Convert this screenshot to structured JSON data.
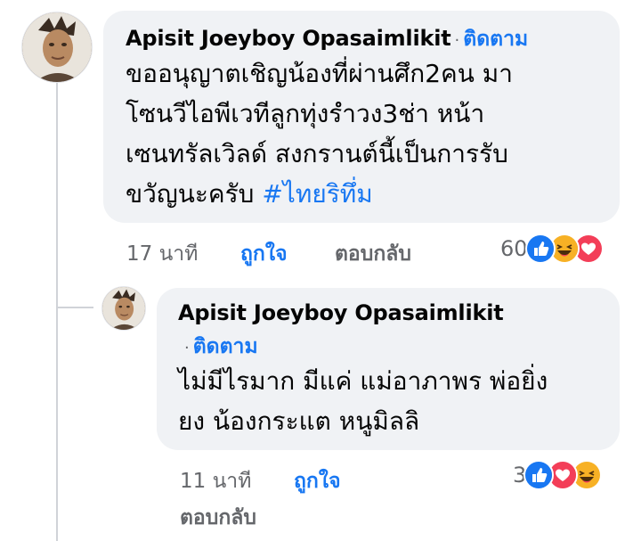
{
  "comment": {
    "author": "Apisit Joeyboy Opasaimlikit",
    "separator": "·",
    "follow_label": "ติดตาม",
    "text_lines": [
      "ขออนุญาตเชิญน้องที่ผ่านศึก2คน มา",
      "โซนวีไอพีเวทีลูกทุ่งรำวง3ช่า หน้า",
      "เซนทรัลเวิลด์ สงกรานต์นี้เป็นการรับ",
      "ขวัญนะครับ "
    ],
    "hashtag": "#ไทยริทึ่ม",
    "time": "17 นาที",
    "like_label": "ถูกใจ",
    "reply_label": "ตอบกลับ",
    "reaction_count": "60",
    "reactions": [
      "like-icon",
      "haha-icon",
      "love-icon"
    ]
  },
  "reply": {
    "author": "Apisit Joeyboy Opasaimlikit",
    "separator": "·",
    "follow_label": "ติดตาม",
    "text_lines": [
      "ไม่มีไรมาก มีแค่ แม่อาภาพร พ่อยิ่ง",
      "ยง น้องกระแต หนูมิลลิ"
    ],
    "time": "11 นาที",
    "like_label": "ถูกใจ",
    "reply_label": "ตอบกลับ",
    "reaction_count": "3",
    "reactions": [
      "like-icon",
      "love-icon",
      "haha-icon"
    ]
  },
  "colors": {
    "link_blue": "#1877f2",
    "bubble_bg": "#f0f2f5",
    "meta_gray": "#65676b",
    "love_red": "#f33e58",
    "haha_yellow": "#f7b125"
  }
}
